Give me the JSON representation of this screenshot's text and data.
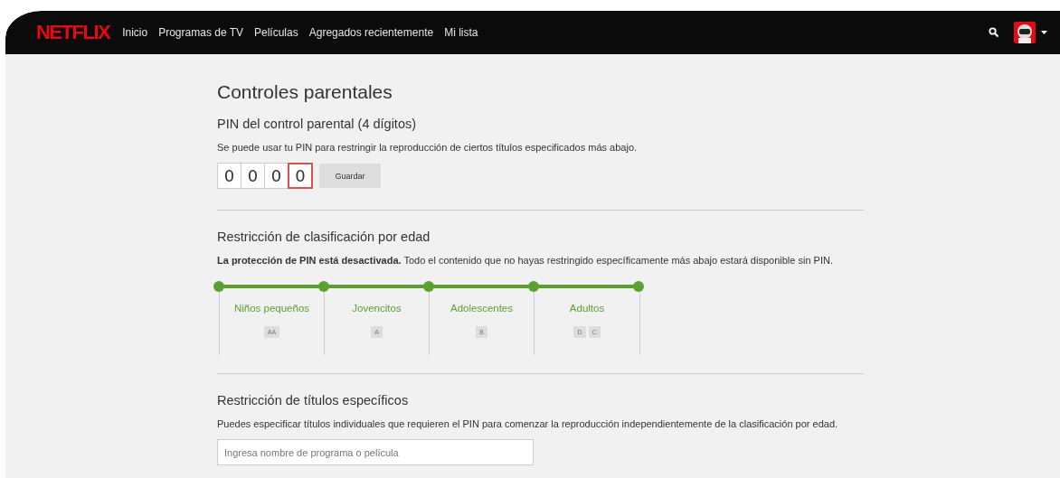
{
  "header": {
    "logo": "NETFLIX",
    "nav": [
      {
        "label": "Inicio"
      },
      {
        "label": "Programas de TV"
      },
      {
        "label": "Películas"
      },
      {
        "label": "Agregados recientemente"
      },
      {
        "label": "Mi lista"
      }
    ]
  },
  "title": "Controles parentales",
  "pin": {
    "heading": "PIN del control parental (4 dígitos)",
    "description": "Se puede usar tu PIN para restringir la reproducción de ciertos títulos especificados más abajo.",
    "digits": [
      {
        "value": "0",
        "focused": false
      },
      {
        "value": "0",
        "focused": false
      },
      {
        "value": "0",
        "focused": false
      },
      {
        "value": "0",
        "focused": true
      }
    ],
    "button": "Guardar"
  },
  "age": {
    "heading": "Restricción de clasificación por edad",
    "notice": "**La protección de PIN está desactivada.** Todo el contenido que no hayas restringido específicamente más abajo estará disponible sin PIN.",
    "levels": [
      {
        "label": "Niños pequeños",
        "active": true,
        "ratings": [
          "AA"
        ]
      },
      {
        "label": "Jovencitos",
        "active": true,
        "ratings": [
          "A"
        ]
      },
      {
        "label": "Adolescentes",
        "active": true,
        "ratings": [
          "B"
        ]
      },
      {
        "label": "Adultos",
        "active": true,
        "ratings": [
          "D",
          "C"
        ]
      }
    ]
  },
  "titles": {
    "heading": "Restricción de títulos específicos",
    "description": "Puedes especificar títulos individuales que requieren el PIN para comenzar la reproducción independientemente de la clasificación por edad.",
    "search": {
      "placeholder": "Ingresa nombre de programa o película"
    }
  }
}
